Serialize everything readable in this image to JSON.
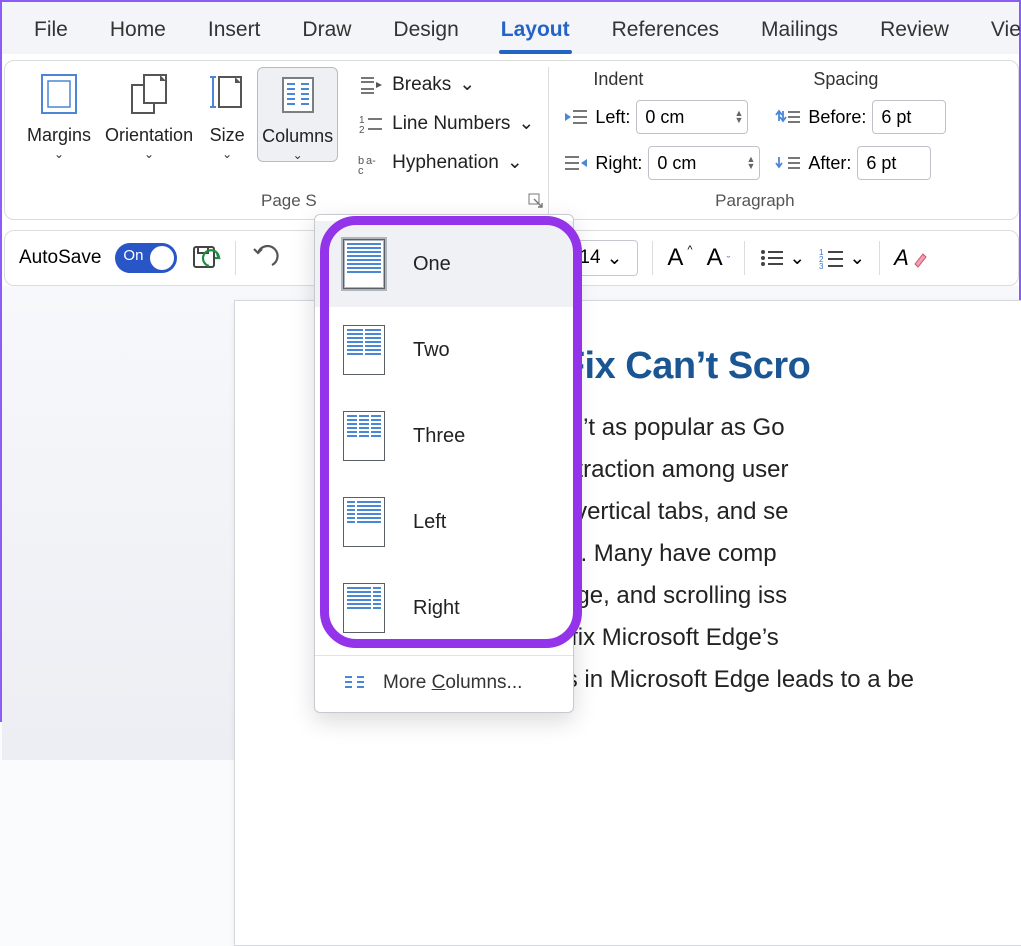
{
  "tabs": [
    "File",
    "Home",
    "Insert",
    "Draw",
    "Design",
    "Layout",
    "References",
    "Mailings",
    "Review",
    "View"
  ],
  "active_tab": "Layout",
  "page_setup": {
    "margins": "Margins",
    "orientation": "Orientation",
    "size": "Size",
    "columns": "Columns",
    "breaks": "Breaks",
    "line_numbers": "Line Numbers",
    "hyphenation": "Hyphenation",
    "caption_partial": "Page S"
  },
  "paragraph": {
    "indent_label": "Indent",
    "spacing_label": "Spacing",
    "left_label": "Left:",
    "right_label": "Right:",
    "before_label": "Before:",
    "after_label": "After:",
    "left_value": "0 cm",
    "right_value": "0 cm",
    "before_value": "6 pt",
    "after_value": "6 pt",
    "caption": "Paragraph"
  },
  "columns_menu": {
    "items": [
      "One",
      "Two",
      "Three",
      "Left",
      "Right"
    ],
    "selected": "One",
    "more": "More Columns..."
  },
  "qat": {
    "autosave": "AutoSave",
    "autosave_state": "On",
    "font_size": "14"
  },
  "document": {
    "title_fragment": "Ways to Fix Can’t Scro",
    "body_fragments": [
      "crosoft Edge isn’t as popular as Go",
      "wser is gaining traction among user",
      "bs, collections, vertical tabs, and se",
      "bug-free though. Many have comp",
      "gh memory usage, and scrolling iss",
      "e best ways to fix Microsoft Edge’s",
      "Scrolling issues in Microsoft Edge leads to a be"
    ]
  },
  "colors": {
    "accent": "#2563c7",
    "doc_heading": "#1b5694",
    "highlight_ring": "#9333ea"
  }
}
